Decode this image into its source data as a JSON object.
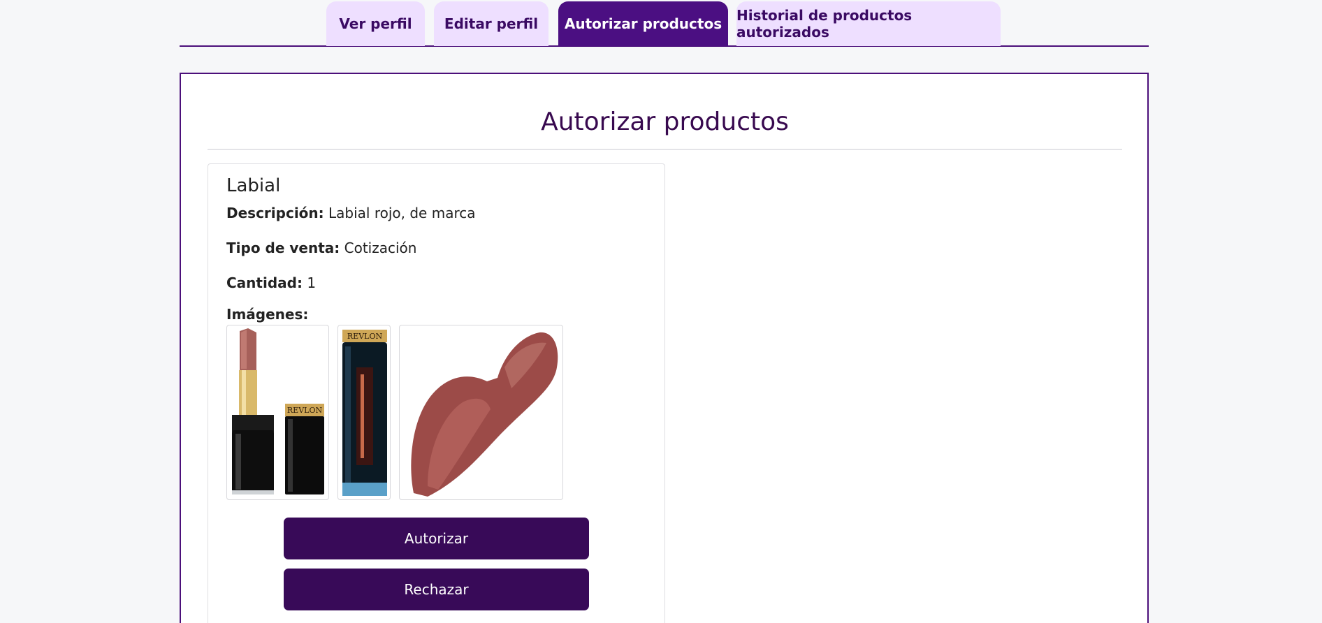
{
  "tabs": [
    {
      "label": "Ver perfil",
      "active": false
    },
    {
      "label": "Editar perfil",
      "active": false
    },
    {
      "label": "Autorizar productos",
      "active": true
    },
    {
      "label": "Historial de productos autorizados",
      "active": false
    }
  ],
  "panel": {
    "title": "Autorizar productos"
  },
  "product": {
    "name": "Labial",
    "description_label": "Descripción:",
    "description": "Labial rojo, de marca",
    "sale_type_label": "Tipo de venta:",
    "sale_type": "Cotización",
    "quantity_label": "Cantidad:",
    "quantity": "1",
    "images_label": "Imágenes:",
    "images": [
      {
        "name": "lipstick-with-cap-image",
        "brand": "REVLON"
      },
      {
        "name": "lipstick-tube-image",
        "brand": "REVLON"
      },
      {
        "name": "lipstick-swatch-image"
      }
    ]
  },
  "actions": {
    "authorize_label": "Autorizar",
    "reject_label": "Rechazar"
  },
  "colors": {
    "accent": "#4b0f82",
    "tab_inactive": "#eedfff",
    "button": "#380a58",
    "title": "#38094f",
    "lipstick": "#9c4b48"
  }
}
